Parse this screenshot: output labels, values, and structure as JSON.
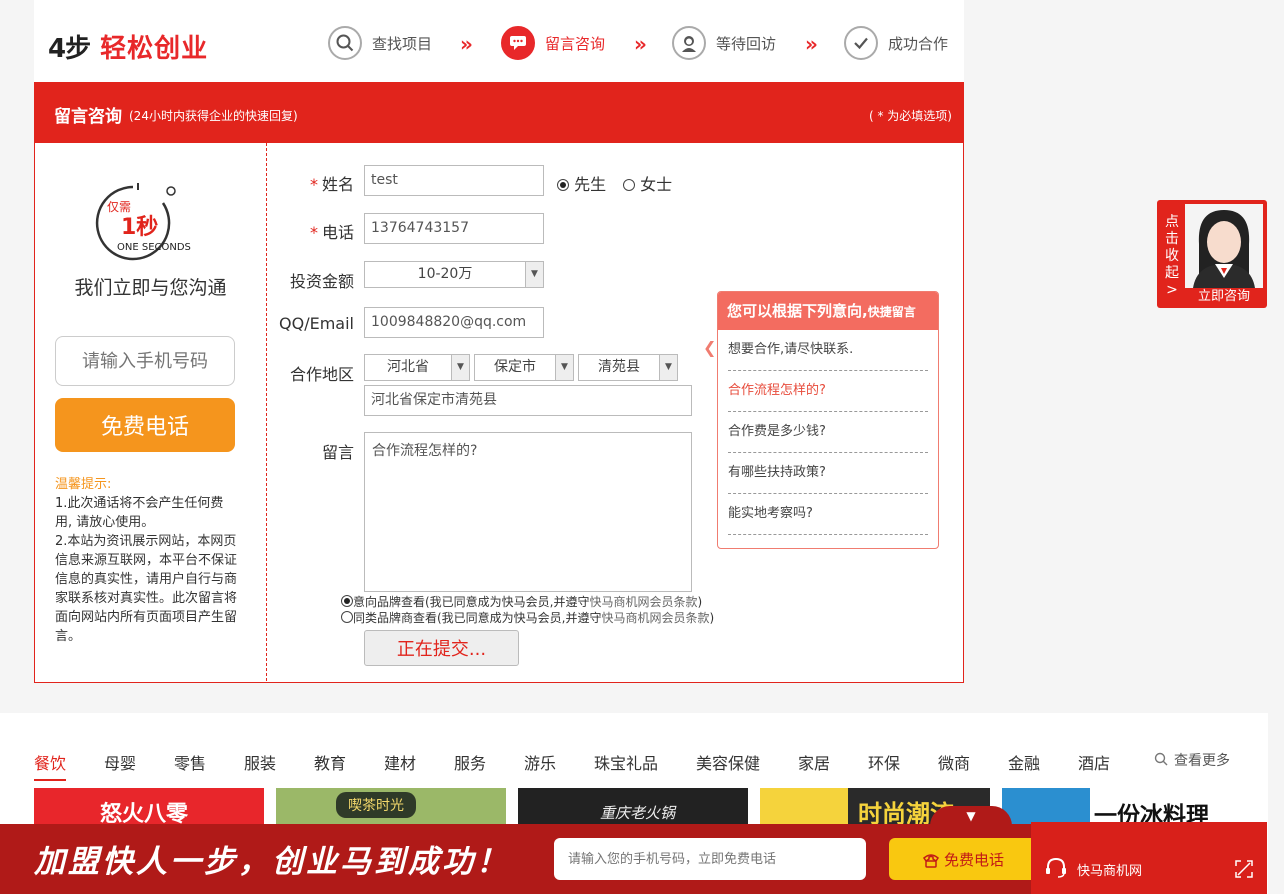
{
  "header": {
    "logo_num": "4步",
    "logo_text": "轻松创业",
    "steps": [
      {
        "label": "查找项目",
        "icon": "search-icon"
      },
      {
        "label": "留言咨询",
        "icon": "chat-icon"
      },
      {
        "label": "等待回访",
        "icon": "agent-icon"
      },
      {
        "label": "成功合作",
        "icon": "check-icon"
      }
    ],
    "arrow": "»"
  },
  "redbar": {
    "title": "留言咨询",
    "subtitle": "(24小时内获得企业的快速回复)",
    "required_note": "( * 为必填选项)"
  },
  "left": {
    "clock_small": "仅需",
    "clock_big": "1秒",
    "clock_en": "ONE SECONDS",
    "tagline": "我们立即与您沟通",
    "phone_placeholder": "请输入手机号码",
    "call_button": "免费电话",
    "tips_title": "温馨提示:",
    "tip1": "1.此次通话将不会产生任何费用, 请放心使用。",
    "tip2": "2.本站为资讯展示网站，本网页信息来源互联网，本平台不保证信息的真实性，请用户自行与商家联系核对真实性。此次留言将面向网站内所有页面项目产生留言。"
  },
  "form": {
    "name_label": "姓名",
    "name_value": "test",
    "gender_male": "先生",
    "gender_female": "女士",
    "phone_label": "电话",
    "phone_value": "13764743157",
    "amount_label": "投资金额",
    "amount_value": "10-20万",
    "qq_label": "QQ/Email",
    "qq_value": "1009848820@qq.com",
    "region_label": "合作地区",
    "province": "河北省",
    "city": "保定市",
    "county": "清苑县",
    "address_value": "河北省保定市清苑县",
    "message_label": "留言",
    "message_value": "合作流程怎样的?",
    "agree1_pre": "意向品牌查看(我已同意成为快马会员,并遵守",
    "agree1_link": "快马商机网会员条款",
    "agree2_pre": "同类品牌商查看(我已同意成为快马会员,并遵守",
    "agree2_link": "快马商机网会员条款",
    "close_paren": ")",
    "submit": "正在提交..."
  },
  "quick": {
    "title": "您可以根据下列意向,",
    "title_small": "快捷留言",
    "items": [
      "想要合作,请尽快联系.",
      "合作流程怎样的?",
      "合作费是多少钱?",
      "有哪些扶持政策?",
      "能实地考察吗?"
    ]
  },
  "side": {
    "vertical": "点击收起",
    "chevron": ">",
    "consult": "立即咨询"
  },
  "categories": [
    "餐饮",
    "母婴",
    "零售",
    "服装",
    "教育",
    "建材",
    "服务",
    "游乐",
    "珠宝礼品",
    "美容保健",
    "家居",
    "环保",
    "微商",
    "金融",
    "酒店"
  ],
  "more": "查看更多",
  "thumbs": [
    "怒火八零",
    "喫茶时光",
    "重庆老火锅",
    "时尚潮流",
    "一份冰料理"
  ],
  "footer": {
    "slogan": "加盟快人一步，创业马到成功！",
    "phone_placeholder": "请输入您的手机号码，立即免费电话",
    "call": "免费电话",
    "chat_label": "快马商机网",
    "toggle": "▼"
  }
}
